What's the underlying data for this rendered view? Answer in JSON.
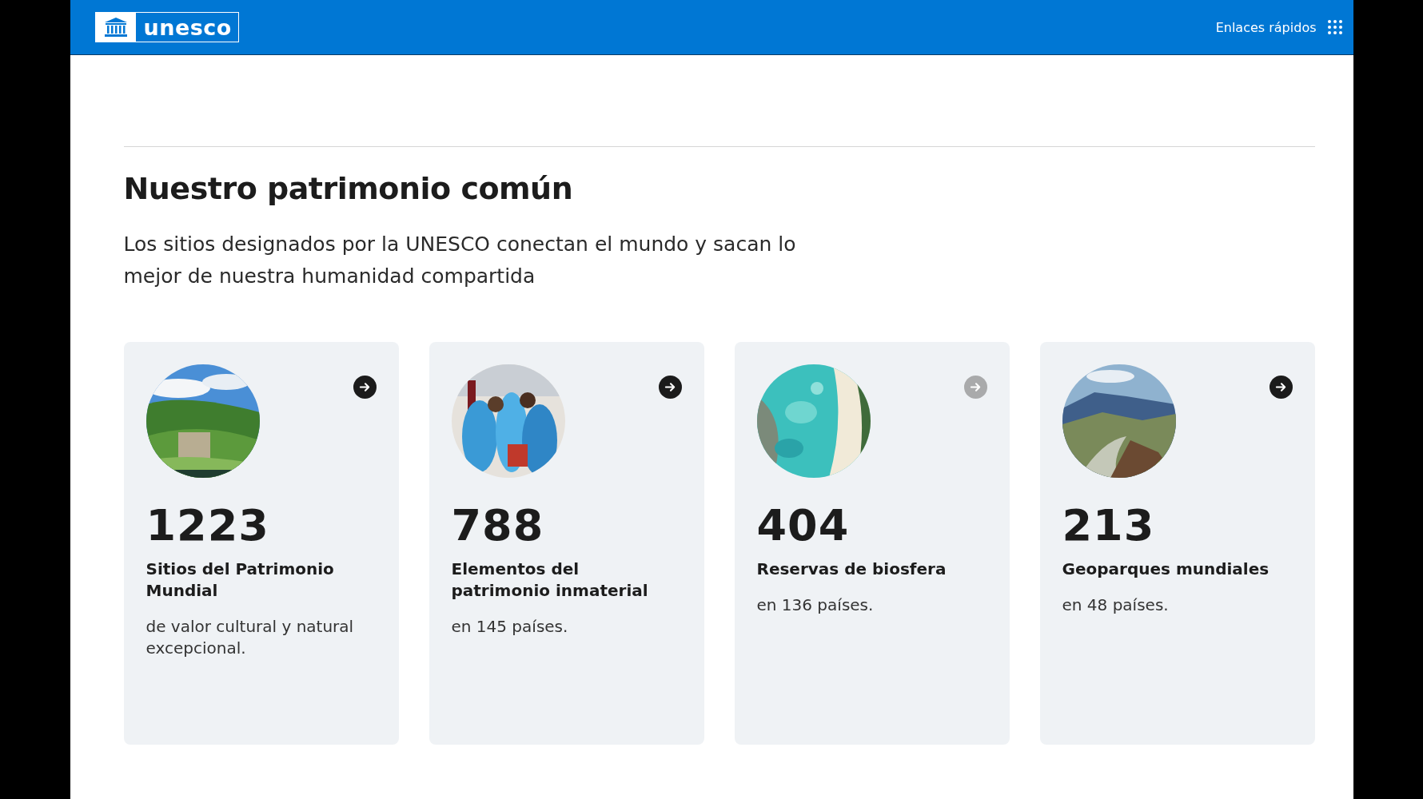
{
  "header": {
    "logo": "unesco",
    "quick_links": "Enlaces rápidos"
  },
  "section": {
    "title": "Nuestro patrimonio común",
    "subtitle": "Los sitios designados por la UNESCO conectan el mundo y sacan lo mejor de nuestra humanidad compartida"
  },
  "cards": [
    {
      "number": "1223",
      "label": "Sitios del Patrimonio Mundial",
      "description": "de valor cultural y natural excepcional.",
      "hovered": false
    },
    {
      "number": "788",
      "label": "Elementos del patrimonio inmaterial",
      "description": "en 145 países.",
      "hovered": false
    },
    {
      "number": "404",
      "label": "Reservas de biosfera",
      "description": "en 136 países.",
      "hovered": true
    },
    {
      "number": "213",
      "label": "Geoparques mundiales",
      "description": "en 48 países.",
      "hovered": false
    }
  ]
}
